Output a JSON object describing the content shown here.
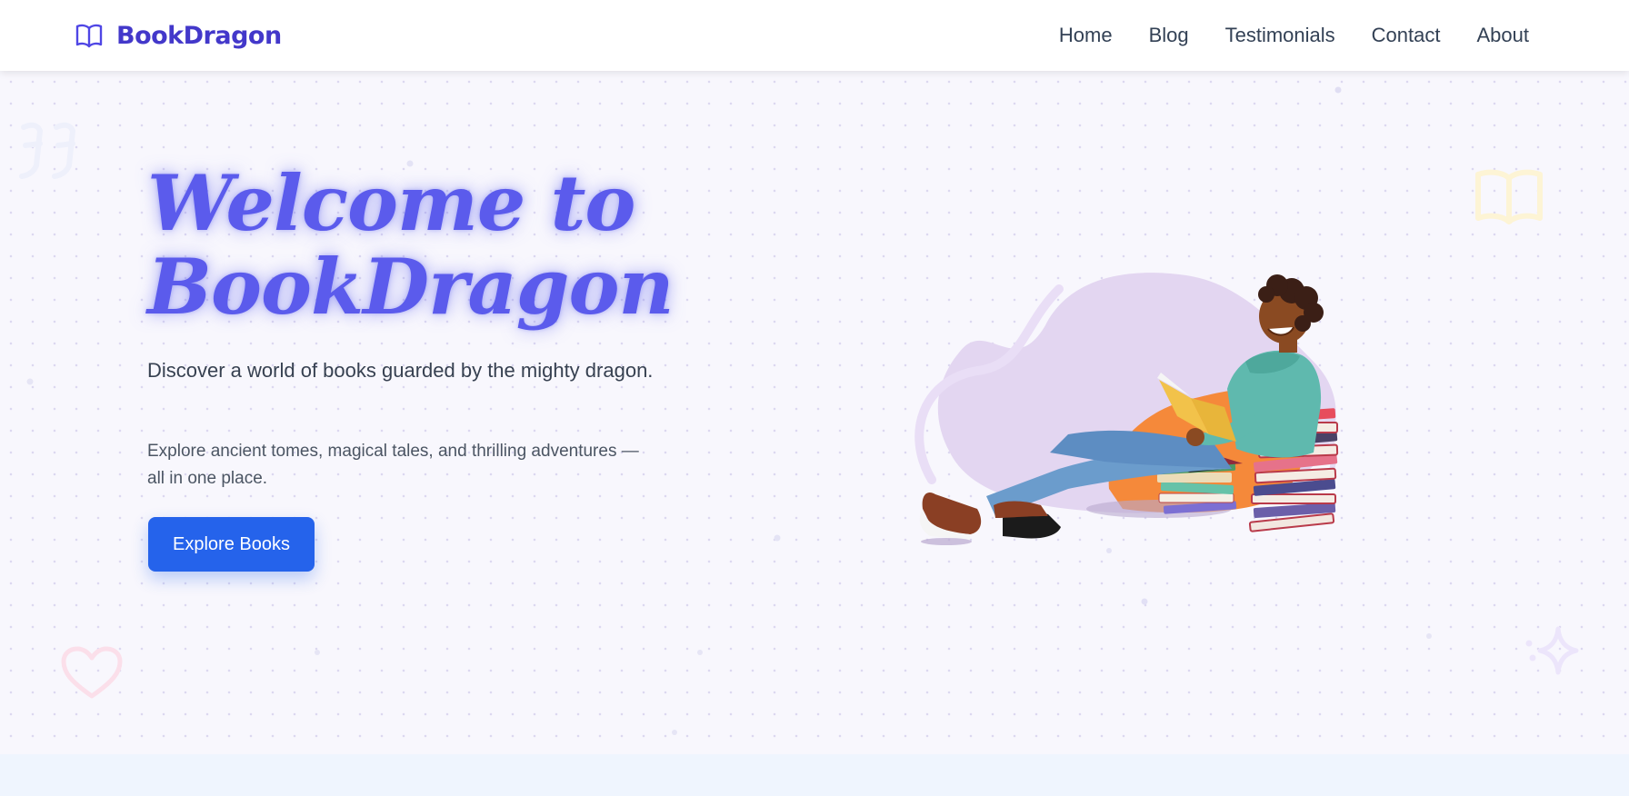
{
  "brand": {
    "name": "BookDragon",
    "icon": "open-book-icon"
  },
  "nav": {
    "links": [
      {
        "label": "Home"
      },
      {
        "label": "Blog"
      },
      {
        "label": "Testimonials"
      },
      {
        "label": "Contact"
      },
      {
        "label": "About"
      }
    ]
  },
  "hero": {
    "title_line1": "Welcome to",
    "title_line2": "BookDragon",
    "subtitle": "Discover a world of books guarded by the mighty dragon.",
    "description": "Explore ancient tomes, magical tales, and thrilling adventures — all in one place.",
    "cta_label": "Explore Books",
    "illustration": "person-reading-on-beanbag-with-book-stacks"
  },
  "decorations": {
    "icons": [
      "quote-icon",
      "book-outline-icon",
      "heart-icon",
      "sparkle-icon"
    ]
  },
  "colors": {
    "brand": "#4338ca",
    "title": "#5b5bec",
    "cta": "#2563eb",
    "hero_bg": "#f8f7fd",
    "bottom_band": "#eff5fe"
  }
}
